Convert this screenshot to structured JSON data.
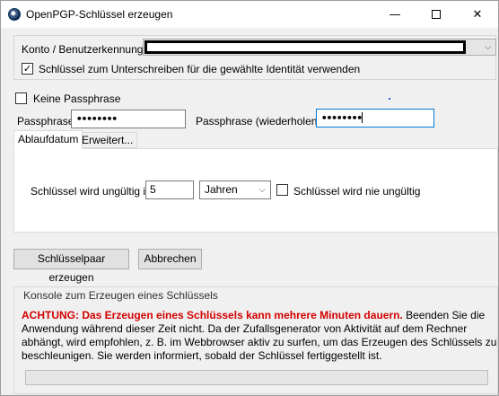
{
  "window": {
    "title": "OpenPGP-Schlüssel erzeugen",
    "minimize_glyph": "—",
    "close_glyph": "✕"
  },
  "account": {
    "label": "Konto / Benutzerkennung",
    "value": "",
    "dropdown_icon": "chevron-down-icon",
    "sign_checked": true,
    "sign_label": "Schlüssel zum Unterschreiben für die gewählte Identität verwenden"
  },
  "passphrase": {
    "no_passphrase_checked": false,
    "no_passphrase_label": "Keine Passphrase",
    "label": "Passphrase",
    "value_masked": "••••••••",
    "repeat_label": "Passphrase (wiederholen)",
    "repeat_value_masked": "••••••••"
  },
  "tabs": [
    {
      "label": "Ablaufdatum",
      "active": true
    },
    {
      "label": "Erweitert...",
      "active": false
    }
  ],
  "expiry": {
    "label": "Schlüssel wird ungültig in",
    "amount": "5",
    "unit": "Jahren",
    "never_checked": false,
    "never_label": "Schlüssel wird nie ungültig"
  },
  "buttons": {
    "generate": "Schlüsselpaar erzeugen",
    "cancel": "Abbrechen"
  },
  "console": {
    "title": "Konsole zum Erzeugen eines Schlüssels",
    "warning": "ACHTUNG: Das Erzeugen eines Schlüssels kann mehrere Minuten dauern.",
    "message": " Beenden Sie die Anwendung während dieser Zeit nicht. Da der Zufallsgenerator von Aktivität auf dem Rechner abhängt, wird empfohlen, z. B. im Webbrowser aktiv zu surfen, um das Erzeugen des Schlüssels zu beschleunigen. Sie werden informiert, sobald der Schlüssel fertiggestellt ist.",
    "progress": 0
  },
  "colors": {
    "warning": "#d40000",
    "focus_border": "#0078d7",
    "window_bg": "#f0f0f0"
  }
}
